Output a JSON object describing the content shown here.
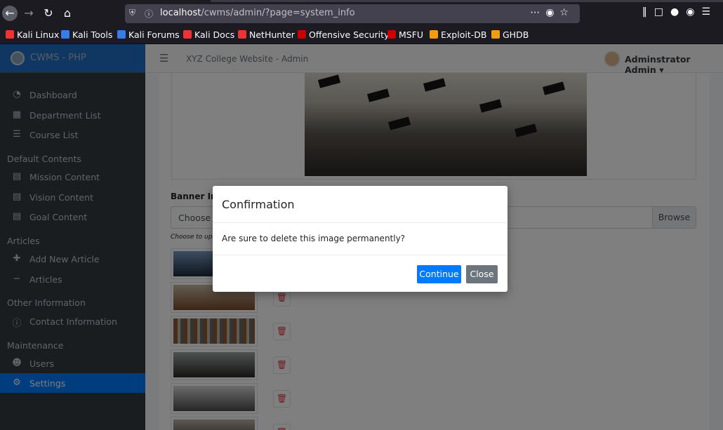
{
  "browser": {
    "url_host": "localhost",
    "url_path": "/cwms/admin/?page=system_info",
    "bookmarks": [
      {
        "label": "Kali Linux",
        "color": "#e33"
      },
      {
        "label": "Kali Tools",
        "color": "#367bf0"
      },
      {
        "label": "Kali Forums",
        "color": "#367bf0"
      },
      {
        "label": "Kali Docs",
        "color": "#e33"
      },
      {
        "label": "NetHunter",
        "color": "#e33"
      },
      {
        "label": "Offensive Security",
        "color": "#c00"
      },
      {
        "label": "MSFU",
        "color": "#c00"
      },
      {
        "label": "Exploit-DB",
        "color": "#f39c12"
      },
      {
        "label": "GHDB",
        "color": "#f39c12"
      }
    ]
  },
  "brand": {
    "title": "CWMS - PHP"
  },
  "topbar": {
    "site_title": "XYZ College Website - Admin",
    "user_name": "Adminstrator Admin"
  },
  "sidebar": {
    "items": [
      {
        "label": "Dashboard",
        "icon": "dashboard-icon"
      },
      {
        "label": "Department List",
        "icon": "building-icon"
      },
      {
        "label": "Course List",
        "icon": "list-icon"
      },
      {
        "label": "Mission Content",
        "icon": "window-icon"
      },
      {
        "label": "Vision Content",
        "icon": "window-icon"
      },
      {
        "label": "Goal Content",
        "icon": "window-icon"
      },
      {
        "label": "Add New Article",
        "icon": "plus-icon"
      },
      {
        "label": "Articles",
        "icon": "rss-icon"
      },
      {
        "label": "Contact Information",
        "icon": "info-icon"
      },
      {
        "label": "Users",
        "icon": "users-icon"
      },
      {
        "label": "Settings",
        "icon": "gears-icon"
      }
    ],
    "headers": [
      "Default Contents",
      "Articles",
      "Other Information",
      "Maintenance"
    ]
  },
  "form": {
    "banner_label": "Banner Ima",
    "file_placeholder": "Choose f",
    "browse_label": "Browse",
    "hint": "Choose to upl"
  },
  "modal": {
    "title": "Confirmation",
    "message": "Are sure to delete this image permanently?",
    "continue_label": "Continue",
    "close_label": "Close"
  }
}
